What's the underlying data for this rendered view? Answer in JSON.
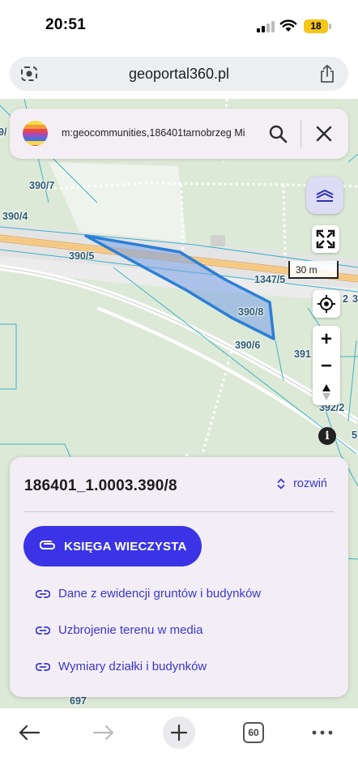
{
  "status_bar": {
    "time": "20:51",
    "battery": "18"
  },
  "browser": {
    "url": "geoportal360.pl",
    "tab_count": "60"
  },
  "search": {
    "query": "m:geocommunities,186401tarnobrzeg Mi"
  },
  "map": {
    "scale_label": "30 m",
    "parcel_labels": {
      "p9": "9/",
      "p390_7": "390/7",
      "p390_4": "390/4",
      "p390_5": "390/5",
      "p1347_5": "1347/5",
      "p390_8": "390/8",
      "p390_6": "390/6",
      "p391": "391",
      "p392_2": "392/2",
      "p2": "2",
      "p3": "3",
      "p5": "5",
      "p697": "697"
    },
    "selected_parcel_color": "#2b7fd6",
    "zoom_in_label": "+",
    "zoom_out_label": "−",
    "info_label": "i"
  },
  "details": {
    "parcel_id": "186401_1.0003.390/8",
    "expand_label": "rozwiń",
    "primary_button": "KSIĘGA WIECZYSTA",
    "links": [
      "Dane z ewidencji gruntów i budynków",
      "Uzbrojenie terenu w media",
      "Wymiary działki i budynków"
    ]
  },
  "colors": {
    "accent": "#3a34e6",
    "link": "#3a37cc"
  }
}
